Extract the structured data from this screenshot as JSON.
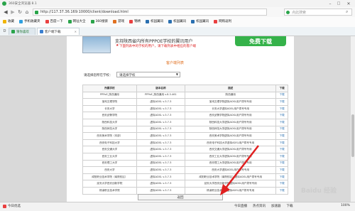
{
  "window": {
    "title": "360安全浏览器 8.1"
  },
  "address": {
    "url": "http://117.37.36.169:10000/client/download.html",
    "search_placeholder": "点此搜索"
  },
  "favorites": [
    {
      "label": "收藏",
      "color": "#f0b400"
    },
    {
      "label": "手机收藏夹",
      "color": "#2fa0e0"
    },
    {
      "label": "百度一下",
      "color": "#e94040"
    },
    {
      "label": "网址大全",
      "color": "#2aa44a"
    },
    {
      "label": "360搜索",
      "color": "#2aa44a"
    },
    {
      "label": "游戏",
      "color": "#e07020"
    },
    {
      "label": "锦绣",
      "color": "#e94040"
    },
    {
      "label": "校园翼讯",
      "color": "#2a6fb0"
    },
    {
      "label": "校园翼讯",
      "color": "#2a6fb0"
    },
    {
      "label": "校园翼讯",
      "color": "#2a6fb0"
    },
    {
      "label": "网购返利",
      "color": "#e94040"
    }
  ],
  "tabs": [
    {
      "label": "猜你喜欢"
    },
    {
      "label": "客户端下载"
    }
  ],
  "page": {
    "support_text": "支持陕西省内所有PPPOE学校的翼讯用户",
    "notice_text": "下面列表中的学校的用户，请下载列表中相应的客户端",
    "download_banner": "免费下载",
    "list_title": "客户端列表",
    "filter_label": "请选择您所在学校：",
    "filter_value": "请选择学校",
    "table": {
      "headers": [
        "所属学校",
        "版本名称",
        "描述",
        "下载"
      ],
      "rows": [
        [
          "PPPoE_陕西通用",
          "PPPoE_陕西通用 v.8.3.461",
          "陕西通用",
          "下载"
        ],
        [
          "宝鸡文理学院",
          "虚拟ADSL v.3.7.3",
          "宝鸡文理学院虚拟ADSL用户拨号专用",
          "下载"
        ],
        [
          "长安大学",
          "虚拟ADSL v.3.7.3",
          "长安大学虚拟ADSL用户拨号专用",
          "下载"
        ],
        [
          "西安武警学院",
          "虚拟ADSL v.3.7.3",
          "西安武警学院虚拟ADSL用户拨号专用",
          "下载"
        ],
        [
          "陕西科技大学",
          "虚拟ADSL v.3.7.3",
          "陕西科技大学虚拟ADSL用户拨号专用",
          "下载"
        ],
        [
          "陕西师范大学",
          "虚拟ADSL v.3.7.3",
          "陕西师范大学虚拟ADSL用户拨号专用",
          "下载"
        ],
        [
          "西安美术学院（本部）",
          "虚拟ADSL v.3.7.3",
          "西安美术学院虚拟ADSL用户拨号专用",
          "下载"
        ],
        [
          "西安电子科技大学",
          "虚拟ADSL v.3.7.3",
          "西安电子科技大学虚拟ADSL用户拨号专用",
          "下载"
        ],
        [
          "西安交通大学",
          "虚拟ADSL v.3.7.3",
          "西安交通大学虚拟ADSL用户拨号专用",
          "下载"
        ],
        [
          "西安工业大学",
          "虚拟ADSL v.3.7.3",
          "西安工业大学虚拟ADSL用户拨号专用",
          "下载"
        ],
        [
          "西安理工大学",
          "虚拟ADSL v.3.7.3",
          "西安理工大学虚拟ADSL用户拨号专用",
          "下载"
        ],
        [
          "西安大学",
          "虚拟ADSL v.3.7.3",
          "西安大学虚拟ADSL用户拨号专用",
          "下载"
        ],
        [
          "咸阳职业技术学院（南院校区）",
          "虚拟ADSL v.3.7.3",
          "咸阳职业技术学院（南院校区）虚拟ADSL用户拨号专用",
          "下载"
        ],
        [
          "延安大学西安创新学院",
          "虚拟ADSL v.3.7.3",
          "延安大学西安创新学院虚拟ADSL用户拨号专用",
          "下载"
        ],
        [
          "杨凌职业技术学院",
          "虚拟ADSL v.3.7.3",
          "杨凌职业技术学院虚拟ADSL用户拨号专用",
          "下载"
        ]
      ]
    },
    "back_button": "返回"
  },
  "status": {
    "left": "今日优选",
    "items": [
      "今日直播",
      "热点资讯",
      "加速器",
      "下载"
    ],
    "zoom": "100%"
  },
  "watermark": "Baidu 经验"
}
